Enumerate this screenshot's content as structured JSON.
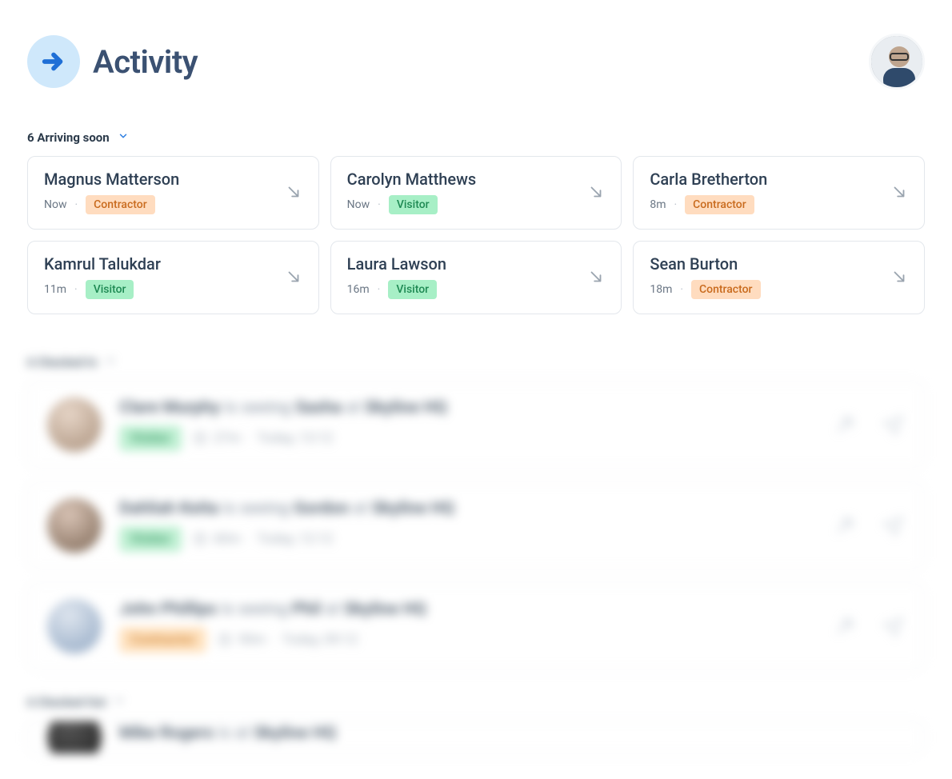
{
  "header": {
    "title": "Activity"
  },
  "arriving": {
    "count_label": "6 Arriving soon",
    "items": [
      {
        "name": "Magnus Matterson",
        "time": "Now",
        "tag": "Contractor",
        "tag_type": "contractor"
      },
      {
        "name": "Carolyn Matthews",
        "time": "Now",
        "tag": "Visitor",
        "tag_type": "visitor"
      },
      {
        "name": "Carla Bretherton",
        "time": "8m",
        "tag": "Contractor",
        "tag_type": "contractor"
      },
      {
        "name": "Kamrul Talukdar",
        "time": "11m",
        "tag": "Visitor",
        "tag_type": "visitor"
      },
      {
        "name": "Laura Lawson",
        "time": "16m",
        "tag": "Visitor",
        "tag_type": "visitor"
      },
      {
        "name": "Sean Burton",
        "time": "18m",
        "tag": "Contractor",
        "tag_type": "contractor"
      }
    ]
  },
  "checked_in": {
    "count_label": "6 Checked In",
    "items": [
      {
        "person": "Clare Murphy",
        "verb": "is seeing",
        "host": "Sasha",
        "at": "at",
        "location": "Skyline HQ",
        "tag": "Visitor",
        "tag_type": "visitor",
        "duration": "27m",
        "timestamp": "Today, 13:12"
      },
      {
        "person": "Dahliah Keita",
        "verb": "is seeing",
        "host": "Gordon",
        "at": "at",
        "location": "Skyline HQ",
        "tag": "Visitor",
        "tag_type": "visitor",
        "duration": "60m",
        "timestamp": "Today, 12:12"
      },
      {
        "person": "John Phillips",
        "verb": "is seeing",
        "host": "Phil",
        "at": "at",
        "location": "Skyline HQ",
        "tag": "Contractor",
        "tag_type": "contractor",
        "duration": "90m",
        "timestamp": "Today, 09:12"
      }
    ]
  },
  "checked_out": {
    "count_label": "6 Checked Out",
    "preview": {
      "person": "Mike Rogers",
      "verb": "is at",
      "location": "Skyline HQ"
    }
  }
}
